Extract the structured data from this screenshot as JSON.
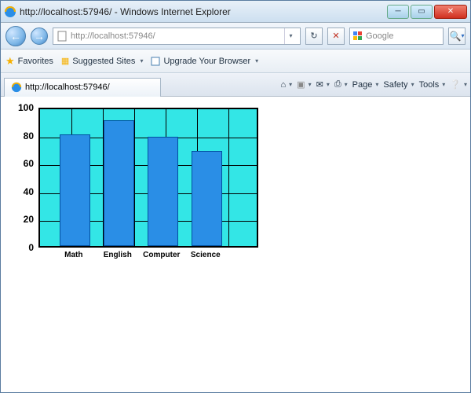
{
  "window": {
    "title": "http://localhost:57946/ - Windows Internet Explorer"
  },
  "nav": {
    "address": "http://localhost:57946/",
    "search_placeholder": "Google"
  },
  "favbar": {
    "favorites": "Favorites",
    "suggested": "Suggested Sites",
    "upgrade": "Upgrade Your Browser"
  },
  "tab": {
    "label": "http://localhost:57946/"
  },
  "toolbar": {
    "page": "Page",
    "safety": "Safety",
    "tools": "Tools"
  },
  "chart_data": {
    "type": "bar",
    "categories": [
      "Math",
      "English",
      "Computer",
      "Science"
    ],
    "values": [
      80,
      90,
      78,
      68
    ],
    "title": "",
    "xlabel": "",
    "ylabel": "",
    "ylim": [
      0,
      100
    ],
    "yticks": [
      0,
      20,
      40,
      60,
      80,
      100
    ]
  }
}
